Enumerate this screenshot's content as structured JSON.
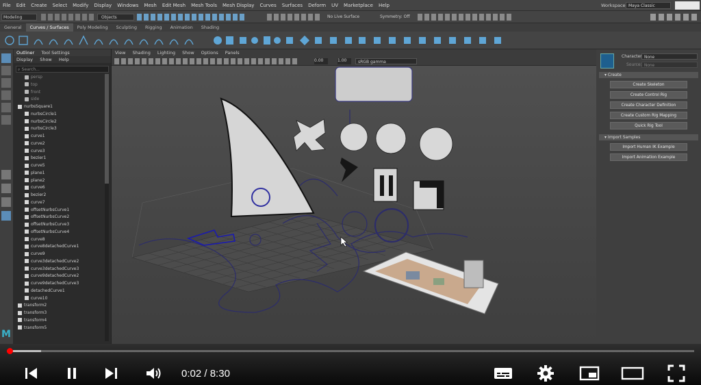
{
  "menubar": {
    "items": [
      "File",
      "Edit",
      "Create",
      "Select",
      "Modify",
      "Display",
      "Windows",
      "Mesh",
      "Edit Mesh",
      "Mesh Tools",
      "Mesh Display",
      "Curves",
      "Surfaces",
      "Deform",
      "UV",
      "Marketplace",
      "Help"
    ],
    "workspace_label": "Workspace :",
    "workspace_value": "Maya Classic"
  },
  "statusline": {
    "mode": "Modeling",
    "objects": "Objects",
    "live_surface": "No Live Surface",
    "symmetry": "Symmetry: Off"
  },
  "shelf_tabs": [
    "General",
    "Curves / Surfaces",
    "Poly Modeling",
    "Sculpting",
    "Rigging",
    "Animation",
    "Shading"
  ],
  "shelf_active": "Curves / Surfaces",
  "outliner": {
    "tabs": [
      "Outliner",
      "Tool Settings"
    ],
    "menu": [
      "Display",
      "Show",
      "Help"
    ],
    "search_placeholder": "Search...",
    "items": [
      "persp",
      "top",
      "front",
      "side",
      "nurbsSquare1",
      "nurbsCircle1",
      "nurbsCircle2",
      "nurbsCircle3",
      "curve1",
      "curve2",
      "curve3",
      "bezier1",
      "curve5",
      "plane1",
      "plane2",
      "curve6",
      "bezier2",
      "curve7",
      "offsetNurbsCurve1",
      "offsetNurbsCurve2",
      "offsetNurbsCurve3",
      "offsetNurbsCurve4",
      "curve8",
      "curve8detachedCurve1",
      "curve9",
      "curve3detachedCurve2",
      "curve3detachedCurve3",
      "curve9detachedCurve2",
      "curve9detachedCurve3",
      "detachedCurve1",
      "curve10",
      "transform2",
      "transform3",
      "transform4",
      "transform5"
    ]
  },
  "viewport": {
    "menu": [
      "View",
      "Shading",
      "Lighting",
      "Show",
      "Options",
      "Panels"
    ],
    "value1": "0.00",
    "value2": "1.00",
    "colorspace": "sRGB gamma"
  },
  "hik": {
    "character_label": "Character:",
    "character_value": "None",
    "source_label": "Source:",
    "source_value": "None",
    "create_section": "Create",
    "buttons": [
      "Create Skeleton",
      "Create Control Rig",
      "Create Character Definition",
      "Create Custom Rig Mapping",
      "Quick Rig Tool"
    ],
    "samples_section": "Import Samples",
    "sample_buttons": [
      "Import Human IK Example",
      "Import Animation Example"
    ]
  },
  "player": {
    "current_time": "0:02",
    "separator": " / ",
    "duration": "8:30",
    "progress_fraction": 0.004,
    "buffered_fraction": 0.05,
    "accent": "#ff0000"
  },
  "icons": [
    "skip-back-icon",
    "pause-icon",
    "skip-next-icon",
    "volume-icon",
    "subtitles-icon",
    "gear-icon",
    "miniplayer-icon",
    "theater-icon",
    "fullscreen-icon"
  ]
}
